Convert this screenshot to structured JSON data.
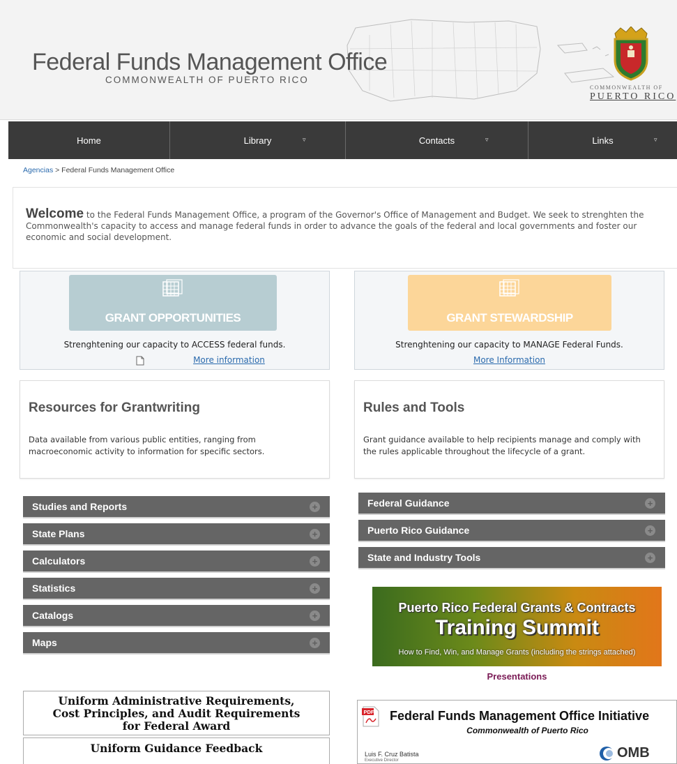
{
  "header": {
    "title": "Federal Funds Management Office",
    "subtitle": "COMMONWEALTH OF PUERTO RICO",
    "seal_line1": "COMMONWEALTH OF",
    "seal_line2": "PUERTO RICO"
  },
  "nav": {
    "items": [
      {
        "label": "Home",
        "dropdown": false
      },
      {
        "label": "Library",
        "dropdown": true
      },
      {
        "label": "Contacts",
        "dropdown": true
      },
      {
        "label": "Links",
        "dropdown": true
      }
    ],
    "caret": "▿"
  },
  "breadcrumb": {
    "link": "Agencias",
    "separator": " > ",
    "current": "Federal Funds Management Office"
  },
  "welcome": {
    "lead": "Welcome",
    "text": " to the Federal Funds Management Office, a program of the Governor's Office of Management and Budget. We seek to strenghten the Commonwealth's capacity to access and manage federal funds in order to advance the goals of the federal and local governments and foster our economic and social development."
  },
  "grant_opportunities": {
    "label": "GRANT OPPORTUNITIES",
    "text": "Strenghtening our capacity to ACCESS federal funds.",
    "link": "More information",
    "color": "#b7cdd2"
  },
  "grant_stewardship": {
    "label": "GRANT STEWARDSHIP",
    "text": "Strenghtening our capacity to MANAGE Federal Funds.",
    "link": "More Information",
    "color": "#fcd699"
  },
  "resources": {
    "title": "Resources for Grantwriting",
    "text": "Data available from various public entities, ranging from macroeconomic activity to information for specific sectors."
  },
  "rules": {
    "title": "Rules and Tools",
    "text": "Grant guidance available to help recipients  manage and comply with the rules applicable throughout the lifecycle of a grant."
  },
  "left_accordion": [
    "Studies and Reports",
    "State Plans",
    "Calculators",
    "Statistics",
    "Catalogs",
    "Maps"
  ],
  "right_accordion": [
    "Federal Guidance",
    "Puerto Rico Guidance",
    "State and Industry Tools"
  ],
  "summit": {
    "line1": "Puerto Rico Federal Grants & Contracts",
    "line2": "Training Summit",
    "line3": "How to Find, Win, and Manage Grants (including the strings attached)",
    "caption": "Presentations"
  },
  "uniform": {
    "box1": "Uniform Administrative Requirements, Cost Principles, and Audit Requirements for Federal Award",
    "box2": "Uniform Guidance Feedback"
  },
  "initiative": {
    "title": "Federal Funds Management Office Initiative",
    "subtitle": "Commonwealth of Puerto Rico",
    "name": "Luis F. Cruz Batista",
    "role": "Executive Director",
    "logo_text": "OMB",
    "pdf_label": "PDF"
  }
}
